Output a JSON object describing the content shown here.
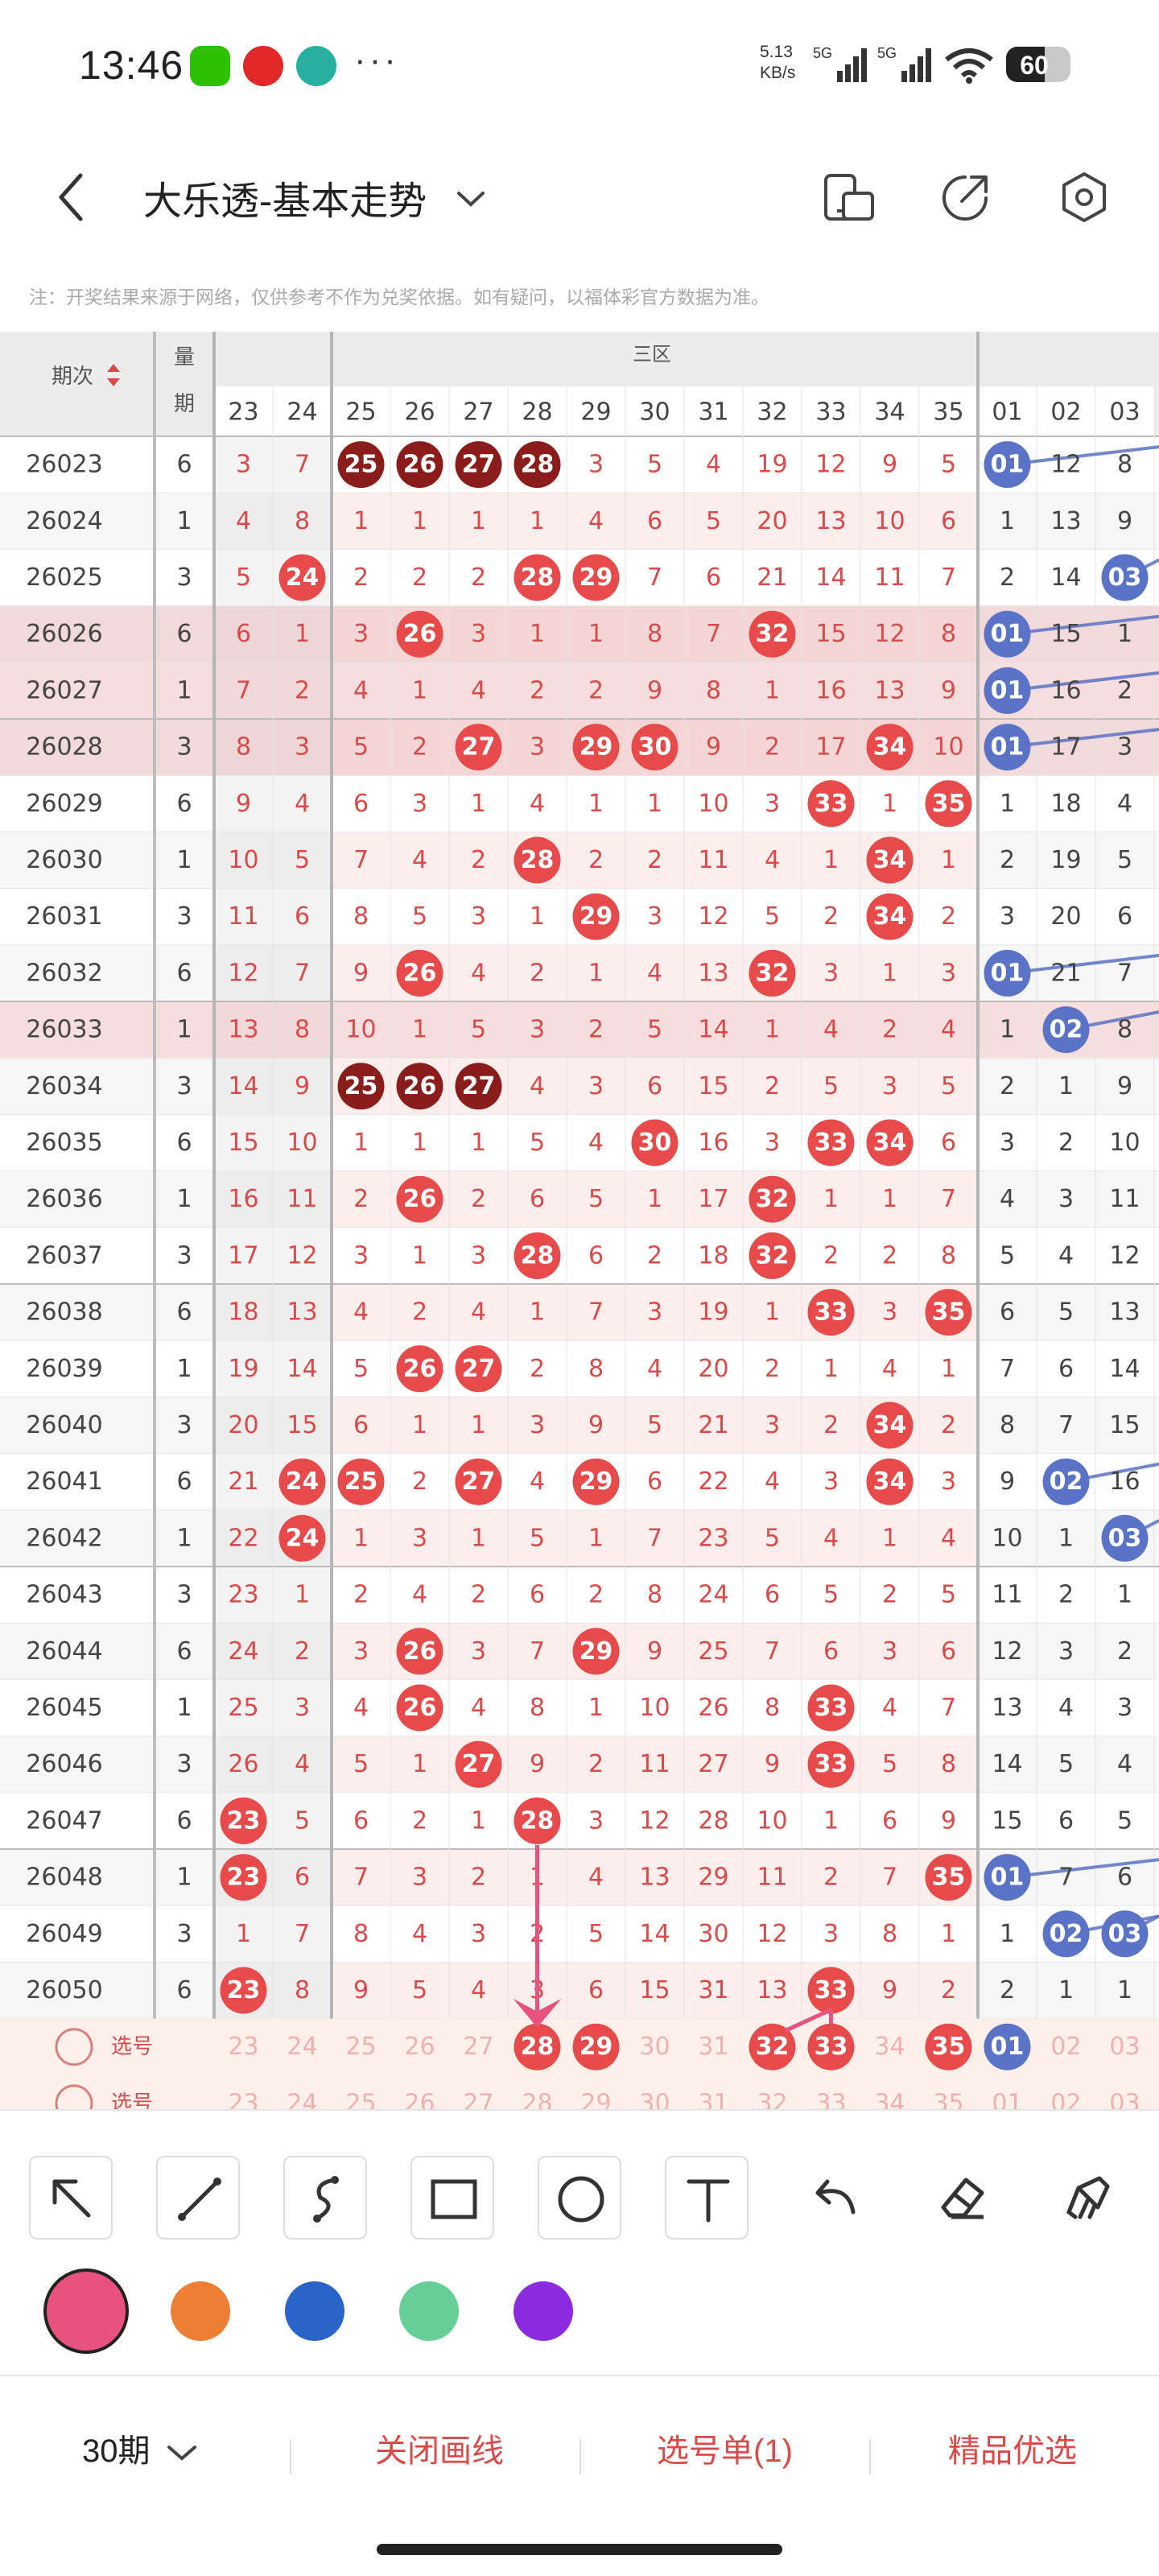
{
  "status_bar": {
    "time": "13:46",
    "icons": [
      "wechat-icon",
      "netease-music-icon",
      "app-icon",
      "more-icon"
    ],
    "more": "···",
    "net_speed_value": "5.13",
    "net_speed_unit": "KB/s",
    "network1": "5G",
    "network2": "5G",
    "battery": "60",
    "battery_level": 0.6
  },
  "header": {
    "title": "大乐透-基本走势",
    "icons": [
      "back-icon",
      "chevron-down-icon",
      "screen-split-icon",
      "share-icon",
      "settings-icon"
    ]
  },
  "disclaimer": "注：开奖结果来源于网络，仅供参考不作为兑奖依据。如有疑问，以福体彩官方数据为准。",
  "table": {
    "period_header": "期次",
    "zone_header": "三区",
    "qty_header_1": "量",
    "qty_header_2": "期",
    "columns": [
      "23",
      "24",
      "25",
      "26",
      "27",
      "28",
      "29",
      "30",
      "31",
      "32",
      "33",
      "34",
      "35",
      "01",
      "02",
      "03"
    ],
    "rows": [
      {
        "p": "26023",
        "q": "6",
        "v": [
          "3",
          "7",
          "25",
          "26",
          "27",
          "28",
          "3",
          "5",
          "4",
          "19",
          "12",
          "9",
          "5",
          "01",
          "12",
          "8"
        ],
        "h": [
          2,
          3,
          4,
          5,
          13
        ],
        "dark": [
          2,
          3,
          4,
          5
        ],
        "blue": [
          13
        ]
      },
      {
        "p": "26024",
        "q": "1",
        "v": [
          "4",
          "8",
          "1",
          "1",
          "1",
          "1",
          "4",
          "6",
          "5",
          "20",
          "13",
          "10",
          "6",
          "1",
          "13",
          "9"
        ],
        "h": [],
        "blue": []
      },
      {
        "p": "26025",
        "q": "3",
        "v": [
          "5",
          "24",
          "2",
          "2",
          "2",
          "28",
          "29",
          "7",
          "6",
          "21",
          "14",
          "11",
          "7",
          "2",
          "14",
          "03"
        ],
        "h": [
          1,
          5,
          6,
          15
        ],
        "blue": [
          15
        ]
      },
      {
        "p": "26026",
        "q": "6",
        "v": [
          "6",
          "1",
          "3",
          "26",
          "3",
          "1",
          "1",
          "8",
          "7",
          "32",
          "15",
          "12",
          "8",
          "01",
          "15",
          "1"
        ],
        "h": [
          3,
          9,
          13
        ],
        "blue": [
          13
        ],
        "band": 1
      },
      {
        "p": "26027",
        "q": "1",
        "v": [
          "7",
          "2",
          "4",
          "1",
          "4",
          "2",
          "2",
          "9",
          "8",
          "1",
          "16",
          "13",
          "9",
          "01",
          "16",
          "2"
        ],
        "h": [
          13
        ],
        "blue": [
          13
        ],
        "band": 1
      },
      {
        "p": "26028",
        "q": "3",
        "v": [
          "8",
          "3",
          "5",
          "2",
          "27",
          "3",
          "29",
          "30",
          "9",
          "2",
          "17",
          "34",
          "10",
          "01",
          "17",
          "3"
        ],
        "h": [
          4,
          6,
          7,
          11,
          13
        ],
        "blue": [
          13
        ],
        "band": 1
      },
      {
        "p": "26029",
        "q": "6",
        "v": [
          "9",
          "4",
          "6",
          "3",
          "1",
          "4",
          "1",
          "1",
          "10",
          "3",
          "33",
          "1",
          "35",
          "1",
          "18",
          "4"
        ],
        "h": [
          10,
          12
        ],
        "blue": []
      },
      {
        "p": "26030",
        "q": "1",
        "v": [
          "10",
          "5",
          "7",
          "4",
          "2",
          "28",
          "2",
          "2",
          "11",
          "4",
          "1",
          "34",
          "1",
          "2",
          "19",
          "5"
        ],
        "h": [
          5,
          11
        ],
        "blue": []
      },
      {
        "p": "26031",
        "q": "3",
        "v": [
          "11",
          "6",
          "8",
          "5",
          "3",
          "1",
          "29",
          "3",
          "12",
          "5",
          "2",
          "34",
          "2",
          "3",
          "20",
          "6"
        ],
        "h": [
          6,
          11
        ],
        "blue": []
      },
      {
        "p": "26032",
        "q": "6",
        "v": [
          "12",
          "7",
          "9",
          "26",
          "4",
          "2",
          "1",
          "4",
          "13",
          "32",
          "3",
          "1",
          "3",
          "01",
          "21",
          "7"
        ],
        "h": [
          3,
          9,
          13
        ],
        "blue": [
          13
        ]
      },
      {
        "p": "26033",
        "q": "1",
        "v": [
          "13",
          "8",
          "10",
          "1",
          "5",
          "3",
          "2",
          "5",
          "14",
          "1",
          "4",
          "2",
          "4",
          "1",
          "02",
          "8"
        ],
        "h": [
          14
        ],
        "blue": [
          14
        ],
        "band": 1
      },
      {
        "p": "26034",
        "q": "3",
        "v": [
          "14",
          "9",
          "25",
          "26",
          "27",
          "4",
          "3",
          "6",
          "15",
          "2",
          "5",
          "3",
          "5",
          "2",
          "1",
          "9"
        ],
        "h": [
          2,
          3,
          4
        ],
        "dark": [
          2,
          3,
          4
        ],
        "blue": []
      },
      {
        "p": "26035",
        "q": "6",
        "v": [
          "15",
          "10",
          "1",
          "1",
          "1",
          "5",
          "4",
          "30",
          "16",
          "3",
          "33",
          "34",
          "6",
          "3",
          "2",
          "10"
        ],
        "h": [
          7,
          10,
          11
        ],
        "blue": []
      },
      {
        "p": "26036",
        "q": "1",
        "v": [
          "16",
          "11",
          "2",
          "26",
          "2",
          "6",
          "5",
          "1",
          "17",
          "32",
          "1",
          "1",
          "7",
          "4",
          "3",
          "11"
        ],
        "h": [
          3,
          9
        ],
        "blue": []
      },
      {
        "p": "26037",
        "q": "3",
        "v": [
          "17",
          "12",
          "3",
          "1",
          "3",
          "28",
          "6",
          "2",
          "18",
          "32",
          "2",
          "2",
          "8",
          "5",
          "4",
          "12"
        ],
        "h": [
          5,
          9
        ],
        "blue": []
      },
      {
        "p": "26038",
        "q": "6",
        "v": [
          "18",
          "13",
          "4",
          "2",
          "4",
          "1",
          "7",
          "3",
          "19",
          "1",
          "33",
          "3",
          "35",
          "6",
          "5",
          "13"
        ],
        "h": [
          10,
          12
        ],
        "blue": []
      },
      {
        "p": "26039",
        "q": "1",
        "v": [
          "19",
          "14",
          "5",
          "26",
          "27",
          "2",
          "8",
          "4",
          "20",
          "2",
          "1",
          "4",
          "1",
          "7",
          "6",
          "14"
        ],
        "h": [
          3,
          4
        ],
        "blue": []
      },
      {
        "p": "26040",
        "q": "3",
        "v": [
          "20",
          "15",
          "6",
          "1",
          "1",
          "3",
          "9",
          "5",
          "21",
          "3",
          "2",
          "34",
          "2",
          "8",
          "7",
          "15"
        ],
        "h": [
          11
        ],
        "blue": []
      },
      {
        "p": "26041",
        "q": "6",
        "v": [
          "21",
          "24",
          "25",
          "2",
          "27",
          "4",
          "29",
          "6",
          "22",
          "4",
          "3",
          "34",
          "3",
          "9",
          "02",
          "16"
        ],
        "h": [
          1,
          2,
          4,
          6,
          11,
          14
        ],
        "blue": [
          14
        ]
      },
      {
        "p": "26042",
        "q": "1",
        "v": [
          "22",
          "24",
          "1",
          "3",
          "1",
          "5",
          "1",
          "7",
          "23",
          "5",
          "4",
          "1",
          "4",
          "10",
          "1",
          "03"
        ],
        "h": [
          1,
          15
        ],
        "blue": [
          15
        ]
      },
      {
        "p": "26043",
        "q": "3",
        "v": [
          "23",
          "1",
          "2",
          "4",
          "2",
          "6",
          "2",
          "8",
          "24",
          "6",
          "5",
          "2",
          "5",
          "11",
          "2",
          "1"
        ],
        "h": [],
        "blue": []
      },
      {
        "p": "26044",
        "q": "6",
        "v": [
          "24",
          "2",
          "3",
          "26",
          "3",
          "7",
          "29",
          "9",
          "25",
          "7",
          "6",
          "3",
          "6",
          "12",
          "3",
          "2"
        ],
        "h": [
          3,
          6
        ],
        "blue": []
      },
      {
        "p": "26045",
        "q": "1",
        "v": [
          "25",
          "3",
          "4",
          "26",
          "4",
          "8",
          "1",
          "10",
          "26",
          "8",
          "33",
          "4",
          "7",
          "13",
          "4",
          "3"
        ],
        "h": [
          3,
          10
        ],
        "blue": []
      },
      {
        "p": "26046",
        "q": "3",
        "v": [
          "26",
          "4",
          "5",
          "1",
          "27",
          "9",
          "2",
          "11",
          "27",
          "9",
          "33",
          "5",
          "8",
          "14",
          "5",
          "4"
        ],
        "h": [
          4,
          10
        ],
        "blue": []
      },
      {
        "p": "26047",
        "q": "6",
        "v": [
          "23",
          "5",
          "6",
          "2",
          "1",
          "28",
          "3",
          "12",
          "28",
          "10",
          "1",
          "6",
          "9",
          "15",
          "6",
          "5"
        ],
        "h": [
          0,
          5
        ],
        "blue": []
      },
      {
        "p": "26048",
        "q": "1",
        "v": [
          "23",
          "6",
          "7",
          "3",
          "2",
          "1",
          "4",
          "13",
          "29",
          "11",
          "2",
          "7",
          "35",
          "01",
          "7",
          "6"
        ],
        "h": [
          0,
          12,
          13
        ],
        "blue": [
          13
        ]
      },
      {
        "p": "26049",
        "q": "3",
        "v": [
          "1",
          "7",
          "8",
          "4",
          "3",
          "2",
          "5",
          "14",
          "30",
          "12",
          "3",
          "8",
          "1",
          "1",
          "02",
          "03"
        ],
        "h": [
          14,
          15
        ],
        "blue": [
          14,
          15
        ]
      },
      {
        "p": "26050",
        "q": "6",
        "v": [
          "23",
          "8",
          "9",
          "5",
          "4",
          "3",
          "6",
          "15",
          "31",
          "13",
          "33",
          "9",
          "2",
          "2",
          "1",
          "1"
        ],
        "h": [
          0,
          10
        ],
        "blue": []
      }
    ],
    "pick_label": "选号",
    "pick_rows": [
      {
        "sel": [
          5,
          6,
          9,
          10,
          12,
          13
        ],
        "blue": [
          13
        ]
      },
      {
        "sel": [],
        "blue": []
      }
    ]
  },
  "toolbar": {
    "tools": [
      "arrow-tool-icon",
      "line-tool-icon",
      "curve-tool-icon",
      "rectangle-tool-icon",
      "circle-tool-icon",
      "text-tool-icon",
      "undo-icon",
      "eraser-icon",
      "clear-icon"
    ]
  },
  "colors": {
    "swatches": [
      "#e7527f",
      "#ee7e33",
      "#2c63c8",
      "#66cf98",
      "#8b2be0"
    ],
    "selected": 0,
    "red_ball": "#e64a4a",
    "dark_ball": "#8b1c1c",
    "blue_ball": "#5b73c7",
    "text_red": "#d94a4a",
    "band": "#efc3c3"
  },
  "bottom_bar": {
    "periods": "30期",
    "close_drawing": "关闭画线",
    "selection_list": "选号单(1)",
    "precise": "精品优选"
  }
}
